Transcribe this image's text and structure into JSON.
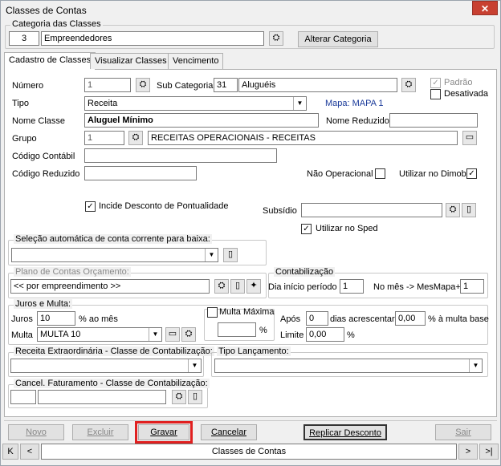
{
  "window": {
    "title": "Classes de Contas",
    "close_icon": "close-icon"
  },
  "categoria": {
    "legend": "Categoria das Classes",
    "code": "3",
    "name": "Empreendedores",
    "alter_button": "Alterar Categoria"
  },
  "tabs": [
    {
      "label": "Cadastro de Classes"
    },
    {
      "label": "Visualizar Classes"
    },
    {
      "label": "Vencimento"
    }
  ],
  "form": {
    "numero_label": "Número",
    "numero_value": "1",
    "subcat_label": "Sub Categoria",
    "subcat_code": "31",
    "subcat_name": "Aluguéis",
    "padrao_label": "Padrão",
    "desativada_label": "Desativada",
    "tipo_label": "Tipo",
    "tipo_value": "Receita",
    "mapa_label": "Mapa: MAPA 1",
    "nome_classe_label": "Nome Classe",
    "nome_classe_value": "Aluguel Mínimo",
    "nome_reduzido_label": "Nome Reduzido",
    "nome_reduzido_value": "",
    "grupo_label": "Grupo",
    "grupo_code": "1",
    "grupo_name": "RECEITAS OPERACIONAIS - RECEITAS",
    "codigo_contabil_label": "Código Contábil",
    "codigo_contabil_value": "",
    "codigo_reduzido_label": "Código Reduzido",
    "codigo_reduzido_value": "",
    "nao_operacional_label": "Não Operacional",
    "utilizar_dimob_label": "Utilizar no Dimob",
    "incide_label": "Incide Desconto de Pontualidade",
    "subsidio_label": "Subsídio",
    "subsidio_value": "",
    "sped_label": "Utilizar no Sped"
  },
  "selecao": {
    "legend": "Seleção automática de conta corrente para baixa:",
    "value": ""
  },
  "plano": {
    "legend": "Plano de Contas Orçamento:",
    "value": "<< por empreendimento >>"
  },
  "contabilizacao": {
    "legend": "Contabilização",
    "dia_label": "Dia início período",
    "dia_value": "1",
    "mes_label": "No mês -> MesMapa+",
    "mes_value": "1"
  },
  "juros": {
    "legend": "Juros e Multa:",
    "juros_label": "Juros",
    "juros_value": "10",
    "juros_suffix": "% ao mês",
    "multa_label": "Multa",
    "multa_value": "MULTA 10",
    "multa_max_label": "Multa Máxima",
    "multa_max_value": "",
    "percent": "%"
  },
  "apos": {
    "apos_label": "Após",
    "apos_value": "0",
    "dias_label": "dias acrescentar",
    "acrescentar_value": "0,00",
    "base_label": "% à multa base",
    "limite_label": "Limite",
    "limite_value": "0,00",
    "percent": "%"
  },
  "receita_extra": {
    "legend": "Receita Extraordinária - Classe de Contabilização:",
    "value": ""
  },
  "tipo_lanc": {
    "legend": "Tipo Lançamento:",
    "value": ""
  },
  "cancel_fat": {
    "legend": "Cancel. Faturamento - Classe de Contabilização:",
    "code": "",
    "value": ""
  },
  "buttons": {
    "novo": "Novo",
    "excluir": "Excluir",
    "gravar": "Gravar",
    "cancelar": "Cancelar",
    "replicar": "Replicar Desconto",
    "sair": "Sair"
  },
  "nav": {
    "first": "K",
    "prev": "<",
    "label": "Classes de Contas",
    "next": ">",
    "last": ">|"
  },
  "colors": {
    "highlight": "#e02020",
    "blue_label": "#1a3a9a"
  }
}
